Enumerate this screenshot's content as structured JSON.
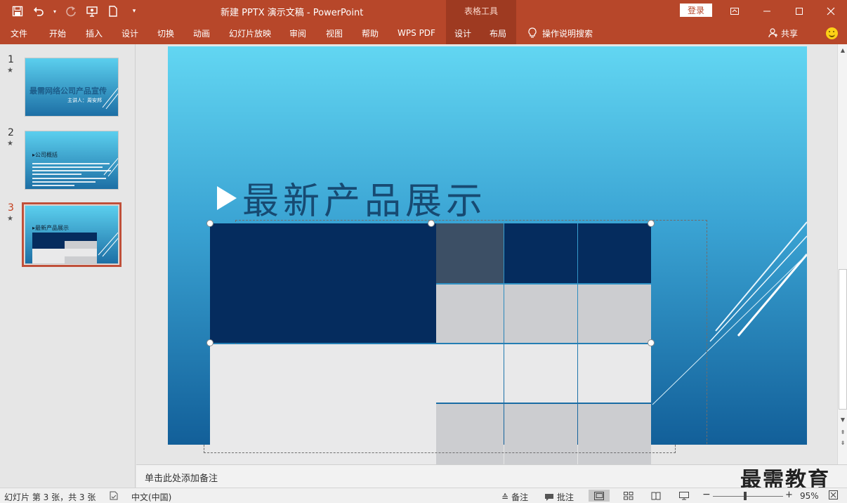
{
  "titlebar": {
    "doc_title": "新建 PPTX 演示文稿  -  PowerPoint",
    "context_header": "表格工具",
    "login_label": "登录"
  },
  "ribbon": {
    "tabs": [
      {
        "label": "文件"
      },
      {
        "label": "开始"
      },
      {
        "label": "插入"
      },
      {
        "label": "设计"
      },
      {
        "label": "切换"
      },
      {
        "label": "动画"
      },
      {
        "label": "幻灯片放映"
      },
      {
        "label": "审阅"
      },
      {
        "label": "视图"
      },
      {
        "label": "帮助"
      },
      {
        "label": "WPS PDF"
      }
    ],
    "context_tabs": [
      {
        "label": "设计"
      },
      {
        "label": "布局"
      }
    ],
    "tell_me": "操作说明搜索",
    "share": "共享"
  },
  "thumbnails": [
    {
      "number": "1",
      "star": "★",
      "title": "最需网络公司产品宣传",
      "subtitle": "主讲人：周安邦"
    },
    {
      "number": "2",
      "star": "★",
      "heading": "▸公司概括"
    },
    {
      "number": "3",
      "star": "★",
      "heading": "▸最新产品展示"
    }
  ],
  "slide": {
    "title": "最新产品展示"
  },
  "notes": {
    "placeholder": "单击此处添加备注",
    "watermark": "最需教育"
  },
  "status": {
    "slide_info": "幻灯片 第 3 张，共 3 张",
    "language": "中文(中国)",
    "notes_btn": "备注",
    "comments_btn": "批注",
    "zoom": "95%"
  },
  "colors": {
    "accent": "#b7472a",
    "context_tab": "#9e3a21",
    "table_header": "#052c5e",
    "table_selected": "#3c4f65",
    "table_light": "#e9e9ea",
    "table_mid": "#cccdd0"
  }
}
